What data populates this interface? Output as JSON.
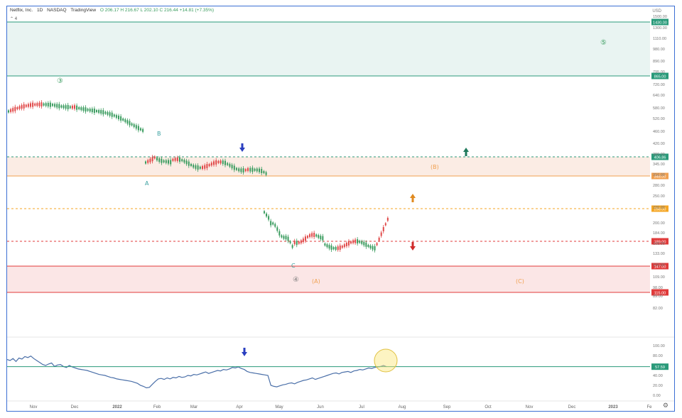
{
  "header": {
    "symbol": "Netflix, Inc.",
    "interval": "1D",
    "exchange": "NASDAQ",
    "source": "TradingView",
    "ohlc": "O 206.17  H 216.67  L 202.10  C 216.44  +14.81 (+7.35%)"
  },
  "stepper_label": "4",
  "currency": "USD",
  "chart_data": {
    "type": "line",
    "title": "",
    "price_axis_ticks": [
      "1500.00",
      "1300.00",
      "1110.00",
      "980.00",
      "890.00",
      "795.00",
      "720.00",
      "640.00",
      "580.00",
      "520.00",
      "460.00",
      "420.00",
      "380.00",
      "345.00",
      "310.00",
      "280.00",
      "250.00",
      "220.00",
      "200.00",
      "184.00",
      "168.00",
      "133.00",
      "120.00",
      "109.00",
      "98.00",
      "89.00",
      "82.00"
    ],
    "price_axis_ticks_positions_note": "",
    "months": [
      "Nov",
      "Dec",
      "2022",
      "Feb",
      "Mar",
      "Apr",
      "May",
      "Jun",
      "Jul",
      "Aug",
      "Sep",
      "Oct",
      "Nov",
      "Dec",
      "2023",
      "Fe"
    ],
    "levels": [
      {
        "label": "1430.00",
        "color": "#2a9a7a",
        "style": "solid"
      },
      {
        "label": "865.00",
        "color": "#2a9a7a",
        "style": "solid"
      },
      {
        "label": "406.86",
        "color": "#2a9a7a",
        "style": "dashed"
      },
      {
        "label": "348.00",
        "color": "#f0a050",
        "style": "solid"
      },
      {
        "label": "258.00",
        "color": "#f5a623",
        "style": "dashed"
      },
      {
        "label": "189.00",
        "color": "#e03a3a",
        "style": "dashed"
      },
      {
        "label": "147.00",
        "color": "#e03a3a",
        "style": "solid"
      },
      {
        "label": "115.00",
        "color": "#e03a3a",
        "style": "solid"
      }
    ],
    "wave_labels": [
      {
        "text": "③",
        "color": "#3a9c5f"
      },
      {
        "text": "⑤",
        "color": "#3a9c5f"
      },
      {
        "text": "④",
        "color": "#777777"
      },
      {
        "text": "B",
        "color": "#3aa0a0"
      },
      {
        "text": "A",
        "color": "#3aa0a0"
      },
      {
        "text": "C",
        "color": "#3aa0a0"
      },
      {
        "text": "(B)",
        "color": "#f0a050"
      },
      {
        "text": "(A)",
        "color": "#f0a050"
      },
      {
        "text": "(C)",
        "color": "#f0a050"
      }
    ],
    "oscillator_axis_ticks": [
      "100.00",
      "80.00",
      "60.00",
      "40.00",
      "20.00",
      "0.00"
    ],
    "oscillator_level": "57.59",
    "series": [
      {
        "values": [
          72,
          70,
          74,
          68,
          75,
          73,
          78,
          76,
          79,
          74,
          70,
          66,
          62,
          60,
          63,
          65,
          58,
          61,
          62,
          58,
          56,
          60,
          57,
          55,
          53,
          52,
          51,
          50,
          48,
          46,
          44,
          42,
          41,
          40,
          38,
          36,
          35,
          33,
          32,
          31,
          30,
          29,
          28,
          26,
          24,
          20,
          18,
          15,
          16,
          22,
          28,
          33,
          34,
          32,
          35,
          33,
          36,
          35,
          38,
          36,
          37,
          40,
          39,
          42,
          41,
          43,
          45,
          47,
          44,
          46,
          48,
          50,
          49,
          52,
          51,
          53,
          56,
          55,
          57,
          54,
          52,
          48,
          46,
          45,
          44,
          43,
          42,
          41,
          40,
          20,
          18,
          17,
          19,
          21,
          22,
          24,
          25,
          23,
          26,
          28,
          30,
          31,
          33,
          35,
          32,
          34,
          36,
          38,
          40,
          42,
          44,
          45,
          43,
          46,
          47,
          48,
          46,
          49,
          50,
          52,
          51,
          53,
          55,
          54,
          56,
          57,
          58,
          60,
          57.6
        ]
      }
    ],
    "candles_note": "",
    "colors": {
      "up": "#3a9c5f",
      "down": "#e04848",
      "rsi": "#4a6fa8"
    }
  }
}
